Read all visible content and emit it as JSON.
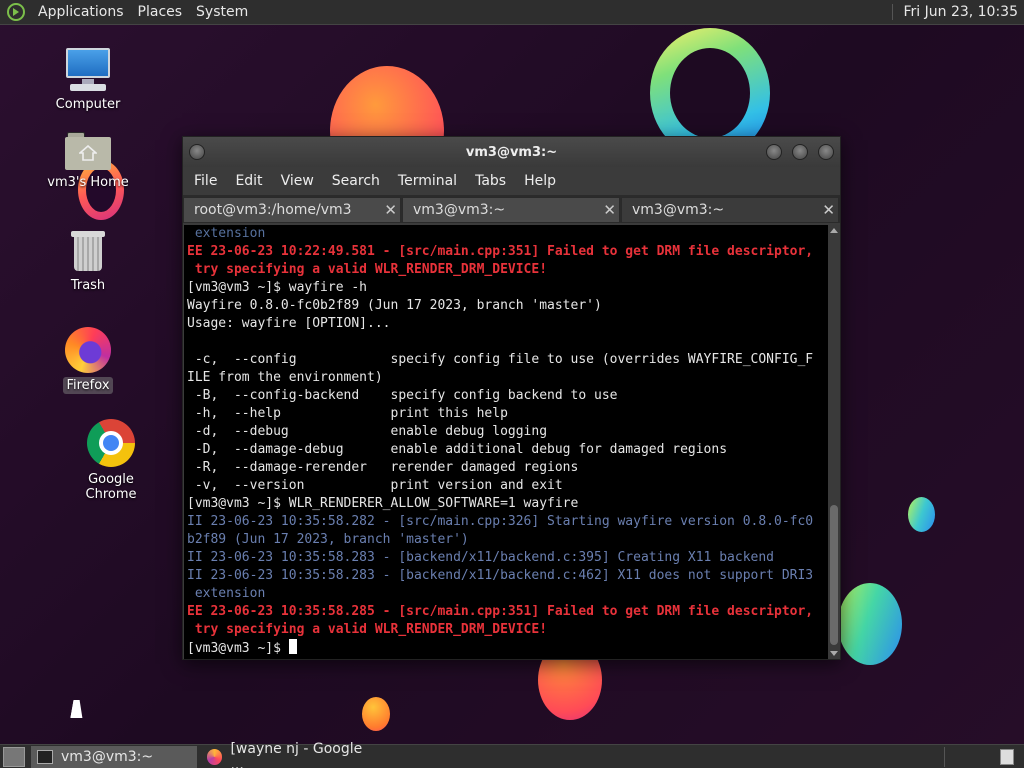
{
  "top_panel": {
    "menus": [
      "Applications",
      "Places",
      "System"
    ],
    "clock": "Fri Jun 23, 10:35"
  },
  "desktop": {
    "icons": [
      {
        "label": "Computer",
        "icon": "computer-icon"
      },
      {
        "label": "vm3's Home",
        "icon": "home-folder-icon"
      },
      {
        "label": "Trash",
        "icon": "trash-icon"
      },
      {
        "label": "Firefox",
        "icon": "firefox-icon"
      },
      {
        "label": "Google Chrome",
        "icon": "chrome-icon"
      }
    ]
  },
  "terminal": {
    "title": "vm3@vm3:~",
    "menu": [
      "File",
      "Edit",
      "View",
      "Search",
      "Terminal",
      "Tabs",
      "Help"
    ],
    "tabs": [
      {
        "label": "root@vm3:/home/vm3",
        "active": false
      },
      {
        "label": "vm3@vm3:~",
        "active": false
      },
      {
        "label": "vm3@vm3:~",
        "active": true
      }
    ],
    "lines": [
      {
        "text": " extension",
        "style": "dim"
      },
      {
        "text": "EE 23-06-23 10:22:49.581 - [src/main.cpp:351] Failed to get DRM file descriptor,",
        "style": "err"
      },
      {
        "text": " try specifying a valid WLR_RENDER_DRM_DEVICE!",
        "style": "err"
      },
      {
        "text": "[vm3@vm3 ~]$ wayfire -h",
        "style": ""
      },
      {
        "text": "Wayfire 0.8.0-fc0b2f89 (Jun 17 2023, branch 'master')",
        "style": ""
      },
      {
        "text": "Usage: wayfire [OPTION]...",
        "style": ""
      },
      {
        "text": "",
        "style": ""
      },
      {
        "text": " -c,  --config            specify config file to use (overrides WAYFIRE_CONFIG_F",
        "style": ""
      },
      {
        "text": "ILE from the environment)",
        "style": ""
      },
      {
        "text": " -B,  --config-backend    specify config backend to use",
        "style": ""
      },
      {
        "text": " -h,  --help              print this help",
        "style": ""
      },
      {
        "text": " -d,  --debug             enable debug logging",
        "style": ""
      },
      {
        "text": " -D,  --damage-debug      enable additional debug for damaged regions",
        "style": ""
      },
      {
        "text": " -R,  --damage-rerender   rerender damaged regions",
        "style": ""
      },
      {
        "text": " -v,  --version           print version and exit",
        "style": ""
      },
      {
        "text": "[vm3@vm3 ~]$ WLR_RENDERER_ALLOW_SOFTWARE=1 wayfire",
        "style": ""
      },
      {
        "text": "II 23-06-23 10:35:58.282 - [src/main.cpp:326] Starting wayfire version 0.8.0-fc0",
        "style": "info"
      },
      {
        "text": "b2f89 (Jun 17 2023, branch 'master')",
        "style": "info"
      },
      {
        "text": "II 23-06-23 10:35:58.283 - [backend/x11/backend.c:395] Creating X11 backend",
        "style": "info"
      },
      {
        "text": "II 23-06-23 10:35:58.283 - [backend/x11/backend.c:462] X11 does not support DRI3",
        "style": "info"
      },
      {
        "text": " extension",
        "style": "info"
      },
      {
        "text": "EE 23-06-23 10:35:58.285 - [src/main.cpp:351] Failed to get DRM file descriptor,",
        "style": "err"
      },
      {
        "text": " try specifying a valid WLR_RENDER_DRM_DEVICE!",
        "style": "err"
      }
    ],
    "prompt": "[vm3@vm3 ~]$ "
  },
  "taskbar": {
    "tasks": [
      {
        "label": "vm3@vm3:~",
        "active": true,
        "icon": "terminal-icon"
      },
      {
        "label": "[wayne nj - Google ...",
        "active": false,
        "icon": "firefox-icon"
      }
    ]
  },
  "colors": {
    "error_text": "#e8323a",
    "info_text": "#6a7fb0",
    "terminal_bg": "#000000",
    "panel_bg": "#2e2e2e"
  }
}
